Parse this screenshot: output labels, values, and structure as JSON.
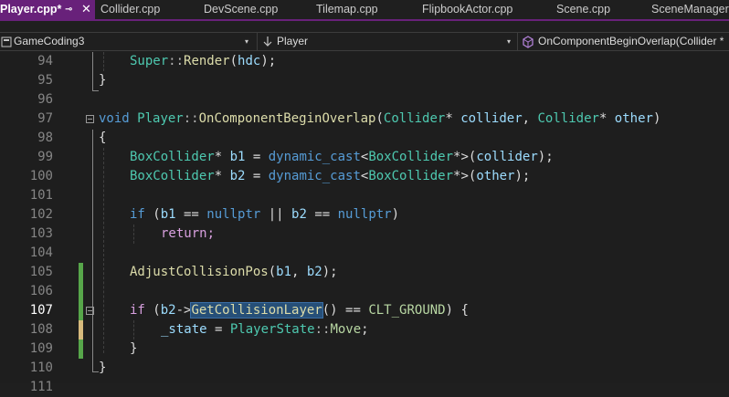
{
  "tabs": [
    {
      "label": "Player.cpp*",
      "active": true
    },
    {
      "label": "Collider.cpp"
    },
    {
      "label": "DevScene.cpp"
    },
    {
      "label": "Tilemap.cpp"
    },
    {
      "label": "FlipbookActor.cpp"
    },
    {
      "label": "Scene.cpp"
    },
    {
      "label": "SceneManager.c"
    }
  ],
  "tab_pin_icon": "⊸",
  "tab_close_icon": "✕",
  "navbar": {
    "project": "GameCoding3",
    "scope": "Player",
    "member": "OnComponentBeginOverlap(Collider *"
  },
  "icons": {
    "project_icon": "project-icon",
    "scope_icon": "arrow-down-icon",
    "member_icon": "method-cube-icon",
    "dropdown": "▾"
  },
  "colors": {
    "active_tab": "#68217a",
    "change_saved": "#57a64a",
    "change_unsaved": "#d7ba7d",
    "selection": "#264f78"
  },
  "editor": {
    "current_line": 107,
    "lines": [
      {
        "num": "94",
        "code": "Super::Render(hdc);"
      },
      {
        "num": "95",
        "code": "}"
      },
      {
        "num": "96",
        "code": ""
      },
      {
        "num": "97",
        "code": "void Player::OnComponentBeginOverlap(Collider* collider, Collider* other)"
      },
      {
        "num": "98",
        "code": "{"
      },
      {
        "num": "99",
        "code": "BoxCollider* b1 = dynamic_cast<BoxCollider*>(collider);"
      },
      {
        "num": "100",
        "code": "BoxCollider* b2 = dynamic_cast<BoxCollider*>(other);"
      },
      {
        "num": "101",
        "code": ""
      },
      {
        "num": "102",
        "code": "if (b1 == nullptr || b2 == nullptr)"
      },
      {
        "num": "103",
        "code": "return;"
      },
      {
        "num": "104",
        "code": ""
      },
      {
        "num": "105",
        "code": "AdjustCollisionPos(b1, b2);"
      },
      {
        "num": "106",
        "code": ""
      },
      {
        "num": "107",
        "code": "if (b2->GetCollisionLayer() == CLT_GROUND) {"
      },
      {
        "num": "108",
        "code": "_state = PlayerState::Move;"
      },
      {
        "num": "109",
        "code": "}"
      },
      {
        "num": "110",
        "code": "}"
      },
      {
        "num": "111",
        "code": ""
      }
    ]
  }
}
